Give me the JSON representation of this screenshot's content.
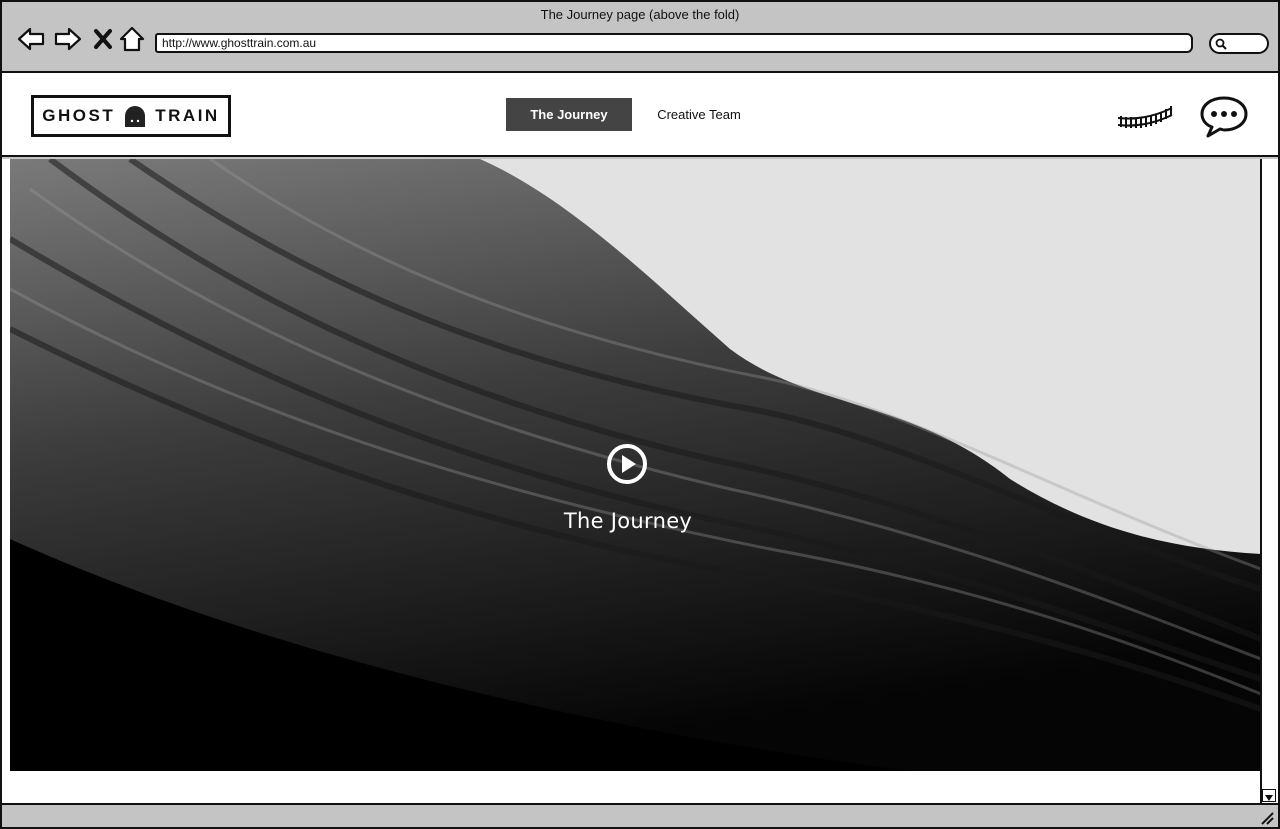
{
  "browser": {
    "window_title": "The Journey page (above the fold)",
    "url": "http://www.ghosttrain.com.au",
    "buttons": {
      "back_icon": "arrow-left-icon",
      "forward_icon": "arrow-right-icon",
      "stop_icon": "close-icon",
      "home_icon": "home-icon",
      "search_icon": "search-icon"
    }
  },
  "site": {
    "logo_left": "GHOST",
    "logo_right": "TRAIN",
    "logo_icon": "ghost-icon",
    "nav": [
      {
        "label": "The Journey",
        "active": true
      },
      {
        "label": "Creative Team",
        "active": false
      }
    ],
    "header_icons": [
      "train-track-icon",
      "chat-bubble-icon"
    ]
  },
  "hero": {
    "title": "The Journey",
    "play_icon": "play-icon"
  },
  "colors": {
    "chrome": "#c4c4c4",
    "active_tab": "#444444",
    "outline": "#111111"
  }
}
